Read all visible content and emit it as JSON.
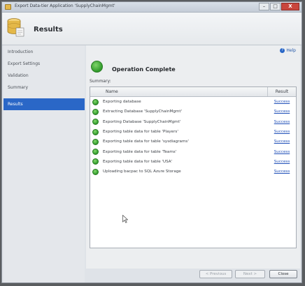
{
  "window": {
    "title": "Export Data-tier Application 'SupplyChainMgmt'",
    "buttons": {
      "minimize": "–",
      "maximize": "□",
      "close": "X"
    }
  },
  "header": {
    "title": "Results"
  },
  "sidebar": {
    "items": [
      {
        "label": "Introduction"
      },
      {
        "label": "Export Settings"
      },
      {
        "label": "Validation"
      },
      {
        "label": "Summary"
      },
      {
        "label": "Results",
        "active": true
      }
    ]
  },
  "content": {
    "help_label": "Help",
    "status_title": "Operation Complete",
    "summary_label": "Summary:",
    "columns": {
      "name": "Name",
      "result": "Result"
    },
    "rows": [
      {
        "name": "Exporting database",
        "result": "Success"
      },
      {
        "name": "Extracting Database 'SupplyChainMgmt'",
        "result": "Success"
      },
      {
        "name": "Exporting Database 'SupplyChainMgmt'",
        "result": "Success"
      },
      {
        "name": "Exporting table data for table 'Players'",
        "result": "Success"
      },
      {
        "name": "Exporting table data for table 'sysdiagrams'",
        "result": "Success"
      },
      {
        "name": "Exporting table data for table 'Teams'",
        "result": "Success"
      },
      {
        "name": "Exporting table data for table 'USA'",
        "result": "Success"
      },
      {
        "name": "Uploading bacpac to SQL Azure Storage",
        "result": "Success"
      }
    ]
  },
  "footer": {
    "previous_label": "< Previous",
    "next_label": "Next >",
    "close_label": "Close"
  },
  "colors": {
    "selection": "#2a67c7",
    "success_green": "#2f9a2a",
    "link": "#1f4fb8"
  }
}
